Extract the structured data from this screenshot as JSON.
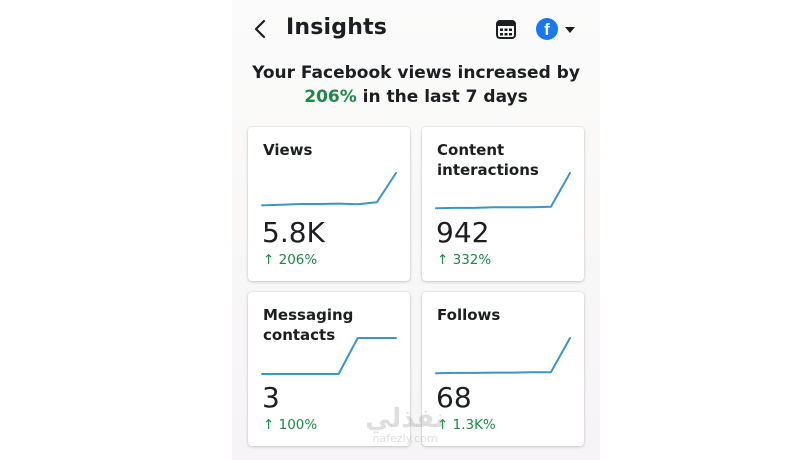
{
  "header": {
    "title": "Insights",
    "back_icon": "chevron-left-icon",
    "calendar_icon": "calendar-icon",
    "platform_icon": "facebook-icon",
    "platform_letter": "f",
    "platform_color": "#1877f2"
  },
  "summary": {
    "line1": "Your Facebook views increased by",
    "percent": "206%",
    "line2_suffix": " in the last 7 days"
  },
  "colors": {
    "positive": "#1a8a46",
    "sparkline": "#3b95c7"
  },
  "cards": [
    {
      "title": "Views",
      "value": "5.8K",
      "change": "↑ 206%",
      "trend": [
        0.1,
        0.12,
        0.14,
        0.14,
        0.15,
        0.13,
        0.19,
        1.0
      ]
    },
    {
      "title": "Content interactions",
      "value": "942",
      "change": "↑ 332%",
      "trend": [
        0.02,
        0.03,
        0.03,
        0.05,
        0.05,
        0.05,
        0.06,
        1.0
      ]
    },
    {
      "title": "Messaging contacts",
      "value": "3",
      "change": "↑ 100%",
      "trend": [
        0.0,
        0.0,
        0.0,
        0.0,
        0.0,
        1.0,
        1.0,
        1.0
      ]
    },
    {
      "title": "Follows",
      "value": "68",
      "change": "↑ 1.3K%",
      "trend": [
        0.02,
        0.03,
        0.03,
        0.04,
        0.04,
        0.05,
        0.05,
        1.0
      ]
    }
  ],
  "watermark": {
    "arabic": "نفذلي",
    "latin": "nafezly.com"
  }
}
